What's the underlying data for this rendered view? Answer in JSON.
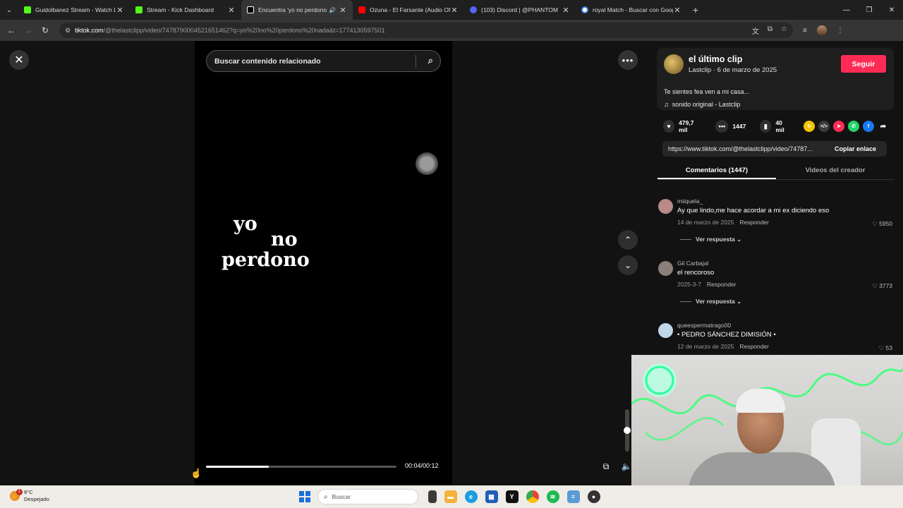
{
  "browser": {
    "tabs": [
      {
        "title": "Guidolbanez Stream - Watch Li",
        "favicon_color": "#53fc18",
        "active": false
      },
      {
        "title": "Stream - Kick Dashboard",
        "favicon_color": "#53fc18",
        "active": false
      },
      {
        "title": "Encuentra 'yo no perdono n",
        "favicon_color": "#ffffff",
        "active": true,
        "audio": true
      },
      {
        "title": "Ozuna - El Farsante (Audio Ofic",
        "favicon_color": "#ff0000",
        "active": false
      },
      {
        "title": "(103) Discord | @PHANTOM",
        "favicon_color": "#5865f2",
        "active": false
      },
      {
        "title": "royal Match - Buscar con Goog",
        "favicon_color": "#4285f4",
        "active": false
      }
    ],
    "url_host": "tiktok.com",
    "url_rest": "/@thelastclipp/video/7478790004521651462?q=yo%20no%20perdono%20nada&t=1774130597501"
  },
  "video": {
    "search_placeholder": "Buscar contenido relacionado",
    "lyric_line1": "yo",
    "lyric_line2": "no",
    "lyric_line3": "perdono",
    "time": "00:04/00:12",
    "progress": 0.33,
    "volume": 0.5
  },
  "post": {
    "username": "el último clip",
    "subline": "Lastclip · 6 de marzo de 2025",
    "follow_label": "Seguir",
    "description": "Te sientes fea ven a mi casa...",
    "sound": "sonido original - Lastclip",
    "likes": "479,7 mil",
    "comments": "1447",
    "saves": "40 mil",
    "link": "https://www.tiktok.com/@thelastclipp/video/74787...",
    "copy_label": "Copiar enlace",
    "tab_comments": "Comentarios (1447)",
    "tab_videos": "Videos del creador"
  },
  "comments": [
    {
      "user": "miiquela_",
      "text": "Ay que lindo,me hace acordar a mi ex diciendo eso",
      "date": "14 de marzo de 2025",
      "reply": "Responder",
      "likes": "5950",
      "more": "Ver respuesta",
      "avatar_color": "#b98a88"
    },
    {
      "user": "Gil Carbajal",
      "text": "el rencoroso",
      "date": "2025-3-7",
      "reply": "Responder",
      "likes": "3773",
      "more": "Ver respuesta",
      "avatar_color": "#8b7f7a"
    },
    {
      "user": "queespermatrago00",
      "text": "• PEDRO SÁNCHEZ DIMISIÓN •",
      "date": "12 de marzo de 2025",
      "reply": "Responder",
      "likes": "53",
      "more": "",
      "avatar_color": "#bfd7e6"
    }
  ],
  "taskbar": {
    "temperature": "8°C",
    "condition": "Despejado",
    "search_placeholder": "Buscar",
    "badge": "1"
  },
  "colors": {
    "accent": "#fe2c55",
    "panel_bg": "#121212"
  }
}
